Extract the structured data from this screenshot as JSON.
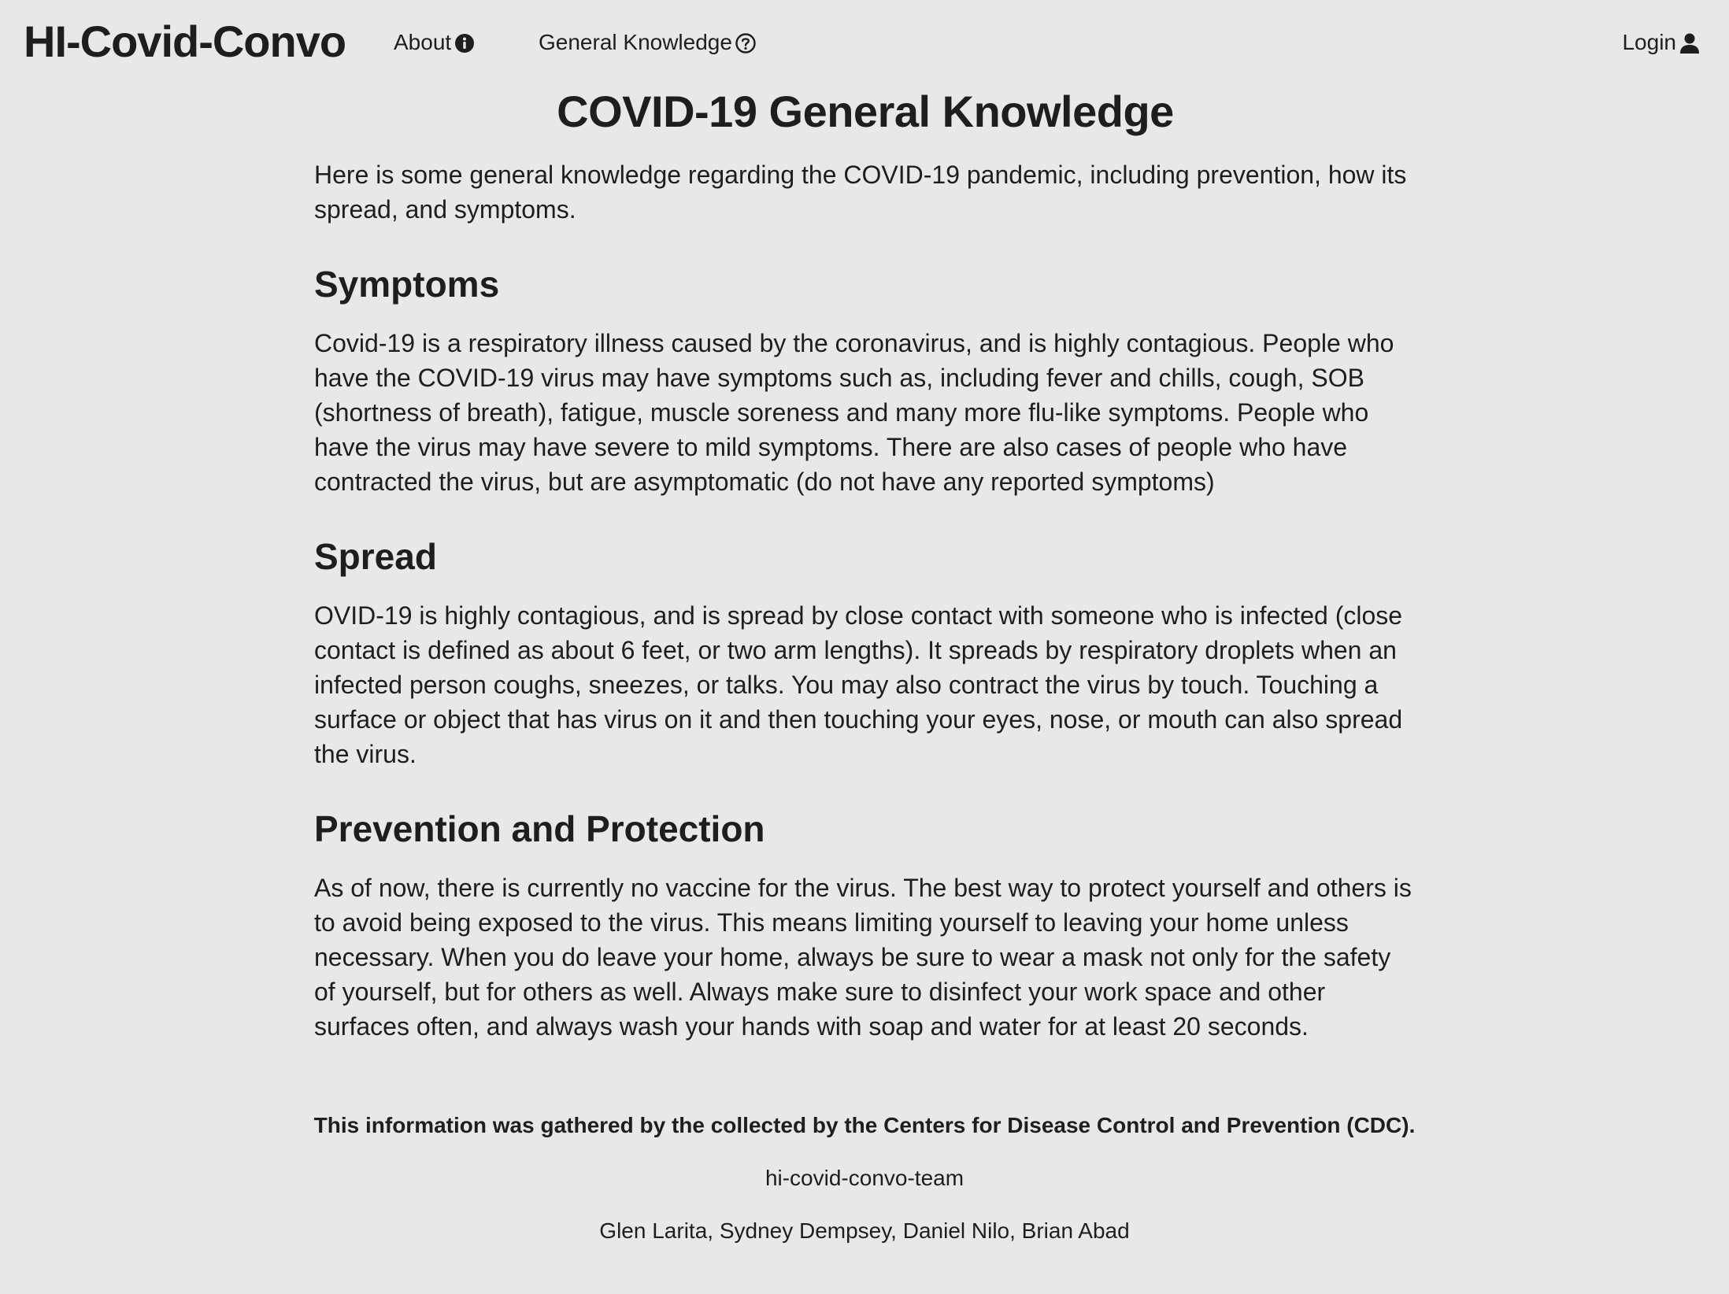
{
  "navbar": {
    "brand": "HI-Covid-Convo",
    "about_label": "About",
    "about_icon": "info-circle-icon",
    "general_label": "General Knowledge",
    "general_icon": "question-circle-icon",
    "login_label": "Login",
    "login_icon": "user-icon"
  },
  "main": {
    "title": "COVID-19 General Knowledge",
    "intro": "Here is some general knowledge regarding the COVID-19 pandemic, including prevention, how its spread, and symptoms.",
    "sections": [
      {
        "heading": "Symptoms",
        "body": "Covid-19 is a respiratory illness caused by the coronavirus, and is highly contagious. People who have the COVID-19 virus may have symptoms such as, including fever and chills, cough, SOB (shortness of breath), fatigue, muscle soreness and many more flu-like symptoms. People who have the virus may have severe to mild symptoms. There are also cases of people who have contracted the virus, but are asymptomatic (do not have any reported symptoms)"
      },
      {
        "heading": "Spread",
        "body": "OVID-19 is highly contagious, and is spread by close contact with someone who is infected (close contact is defined as about 6 feet, or two arm lengths). It spreads by respiratory droplets when an infected person coughs, sneezes, or talks. You may also contract the virus by touch. Touching a surface or object that has virus on it and then touching your eyes, nose, or mouth can also spread the virus."
      },
      {
        "heading": "Prevention and Protection",
        "body": "As of now, there is currently no vaccine for the virus. The best way to protect yourself and others is to avoid being exposed to the virus. This means limiting yourself to leaving your home unless necessary. When you do leave your home, always be sure to wear a mask not only for the safety of yourself, but for others as well. Always make sure to disinfect your work space and other surfaces often, and always wash your hands with soap and water for at least 20 seconds."
      }
    ]
  },
  "footer": {
    "credit": "This information was gathered by the collected by the Centers for Disease Control and Prevention (CDC).",
    "team": "hi-covid-convo-team",
    "members": "Glen Larita, Sydney Dempsey, Daniel Nilo, Brian Abad"
  },
  "colors": {
    "background": "#e8e8e8",
    "text": "#1e1e1e"
  }
}
